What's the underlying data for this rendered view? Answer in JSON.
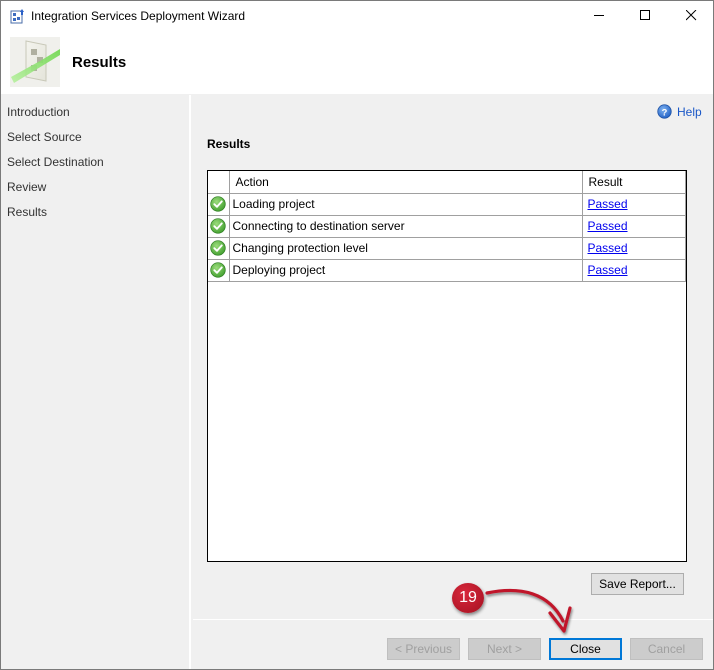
{
  "window": {
    "title": "Integration Services Deployment Wizard",
    "controls": {
      "minimize": "minimize",
      "maximize": "maximize",
      "close": "close"
    }
  },
  "header": {
    "title": "Results",
    "icon": "deployment-wizard-banner-icon"
  },
  "sidebar": {
    "items": [
      {
        "label": "Introduction"
      },
      {
        "label": "Select Source"
      },
      {
        "label": "Select Destination"
      },
      {
        "label": "Review"
      },
      {
        "label": "Results",
        "current": true
      }
    ]
  },
  "main": {
    "help_label": "Help",
    "section_title": "Results",
    "table": {
      "columns": [
        "",
        "Action",
        "Result"
      ],
      "rows": [
        {
          "status": "success",
          "action": "Loading project",
          "result": "Passed"
        },
        {
          "status": "success",
          "action": "Connecting to destination server",
          "result": "Passed"
        },
        {
          "status": "success",
          "action": "Changing protection level",
          "result": "Passed"
        },
        {
          "status": "success",
          "action": "Deploying project",
          "result": "Passed"
        }
      ]
    },
    "save_report_label": "Save Report..."
  },
  "footer": {
    "previous_label": "< Previous",
    "next_label": "Next >",
    "close_label": "Close",
    "cancel_label": "Cancel"
  },
  "annotation": {
    "step_number": "19",
    "color": "#c0142a"
  }
}
